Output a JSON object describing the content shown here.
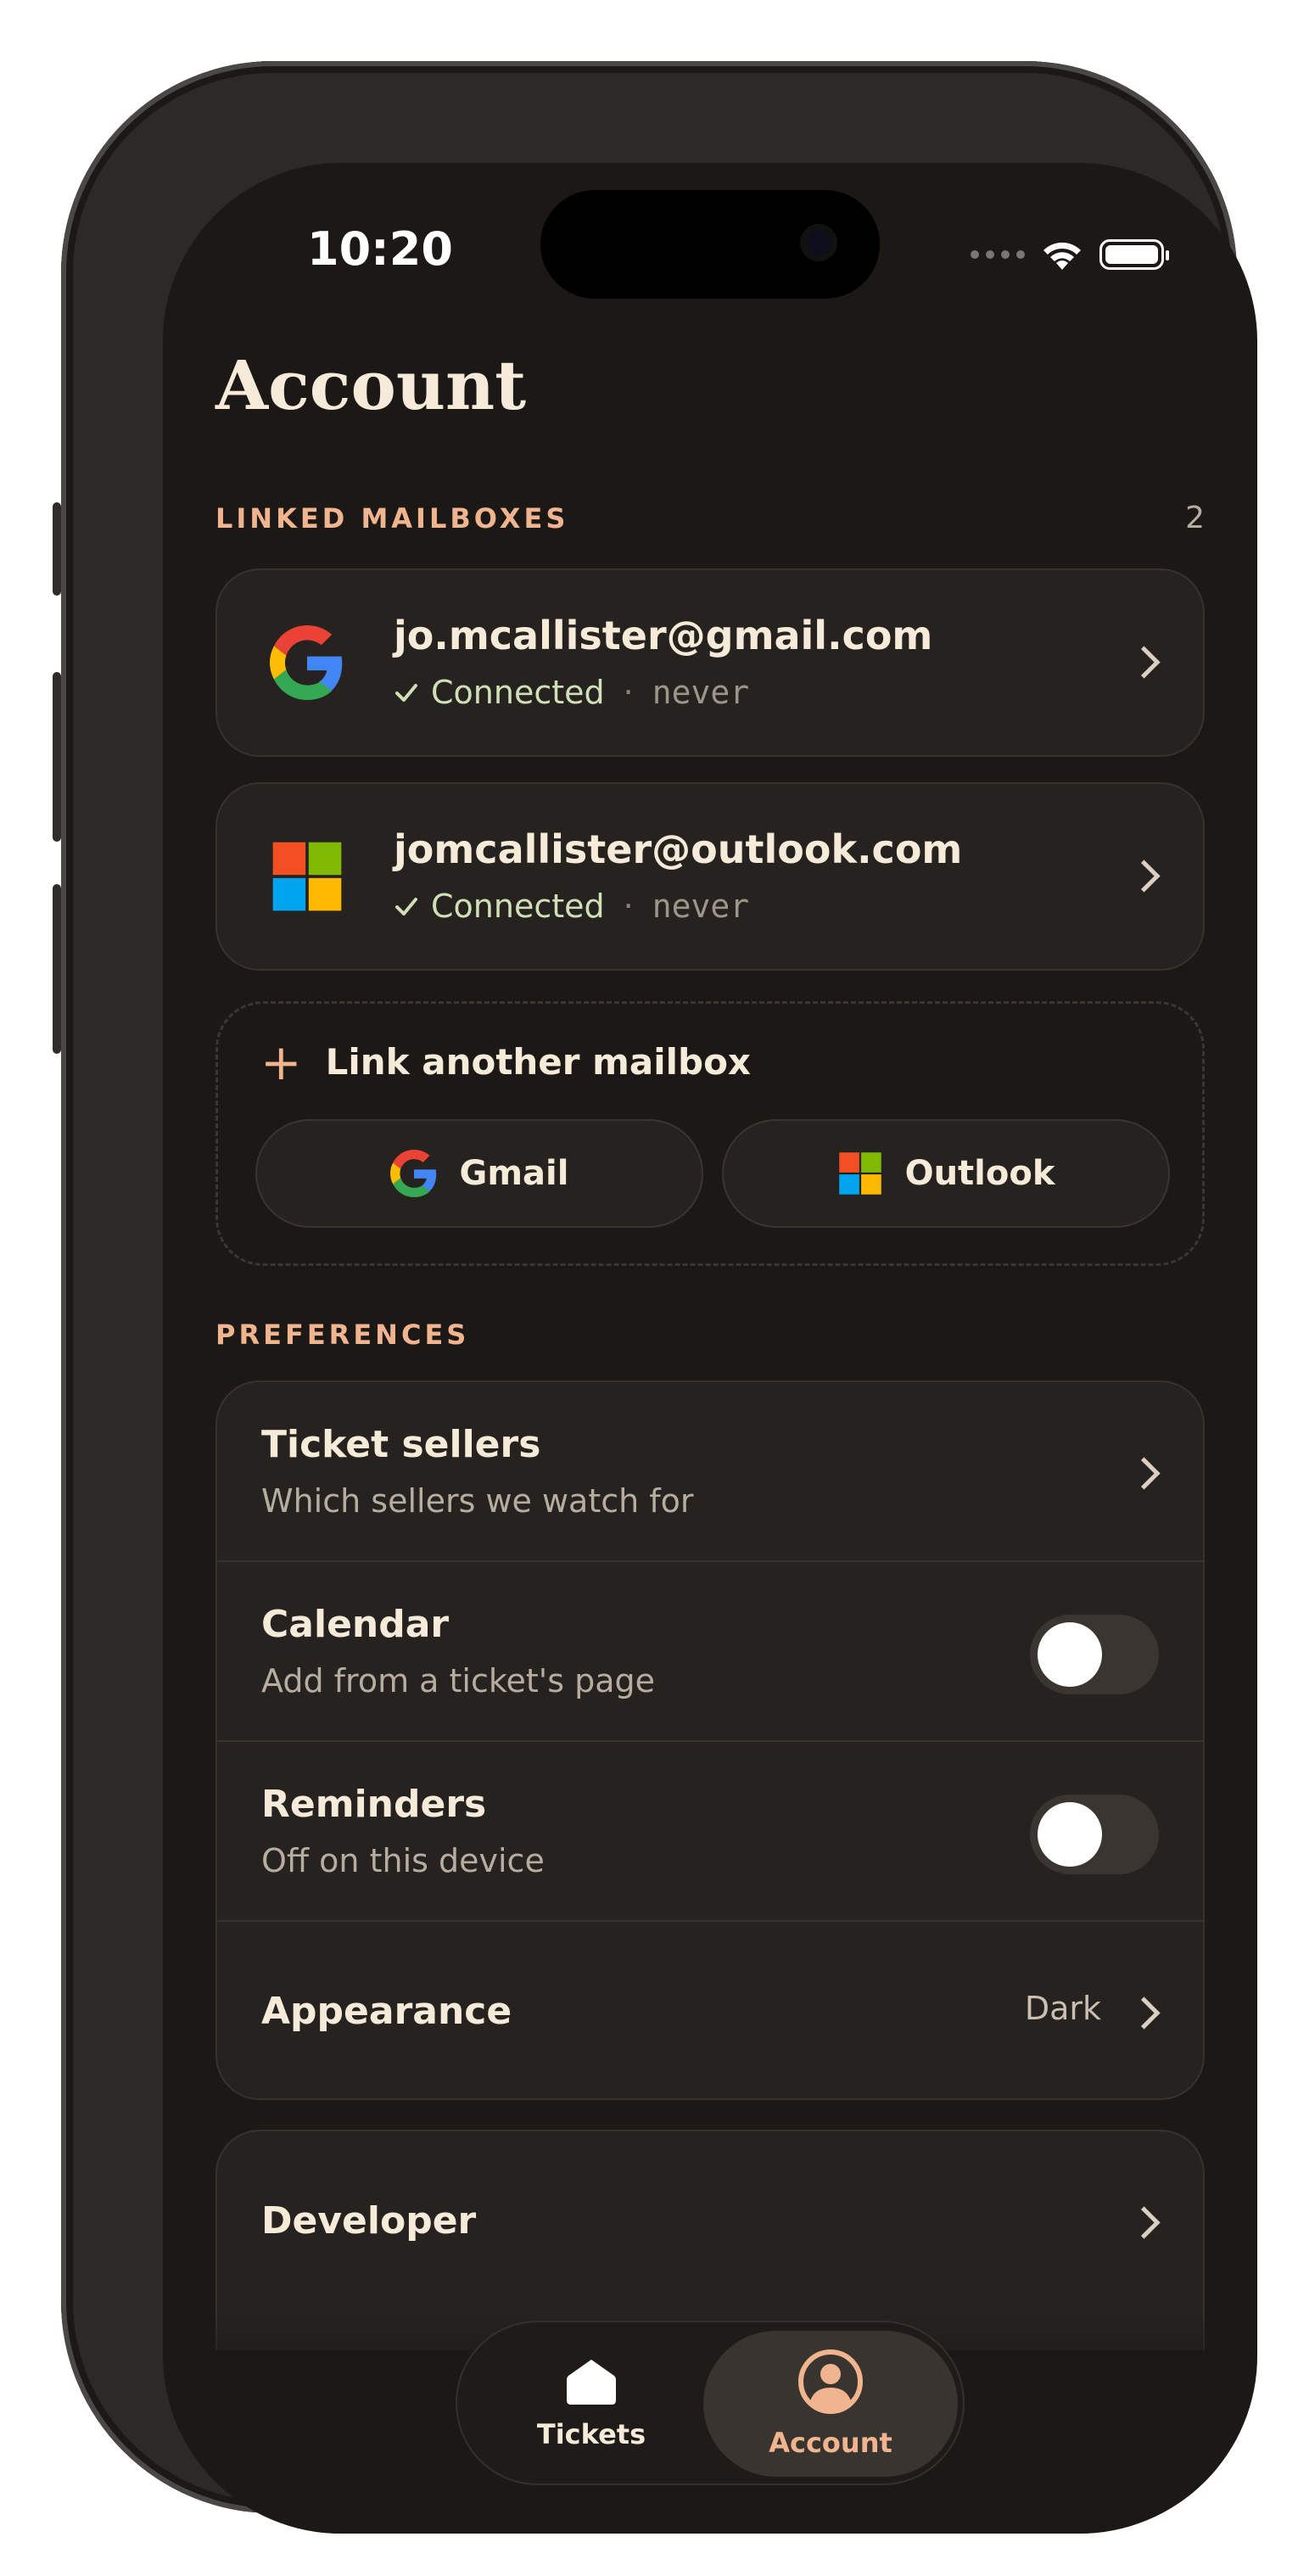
{
  "status_bar": {
    "time": "10:20"
  },
  "page": {
    "title": "Account"
  },
  "linked_mailboxes": {
    "label": "LINKED MAILBOXES",
    "count": "2",
    "items": [
      {
        "email": "jo.mcallister@gmail.com",
        "status": "Connected",
        "separator": "·",
        "last_sync": "never",
        "provider_icon": "google-icon"
      },
      {
        "email": "jomcallister@outlook.com",
        "status": "Connected",
        "separator": "·",
        "last_sync": "never",
        "provider_icon": "microsoft-icon"
      }
    ],
    "link_another": {
      "label": "Link another mailbox",
      "gmail_label": "Gmail",
      "outlook_label": "Outlook"
    }
  },
  "preferences": {
    "label": "PREFERENCES",
    "rows": [
      {
        "title": "Ticket sellers",
        "subtitle": "Which sellers we watch for",
        "control": "chevron"
      },
      {
        "title": "Calendar",
        "subtitle": "Add from a ticket's page",
        "control": "toggle",
        "on": false
      },
      {
        "title": "Reminders",
        "subtitle": "Off on this device",
        "control": "toggle",
        "on": false
      },
      {
        "title": "Appearance",
        "value": "Dark",
        "control": "chevron"
      }
    ]
  },
  "developer": {
    "title": "Developer"
  },
  "tab_bar": {
    "tabs": [
      {
        "label": "Tickets",
        "icon": "home-icon",
        "selected": false
      },
      {
        "label": "Account",
        "icon": "person-icon",
        "selected": true
      }
    ]
  },
  "colors": {
    "background": "#1b1816",
    "card": "#26221f",
    "accent": "#f0b48e",
    "connected": "#cfe0b7"
  }
}
